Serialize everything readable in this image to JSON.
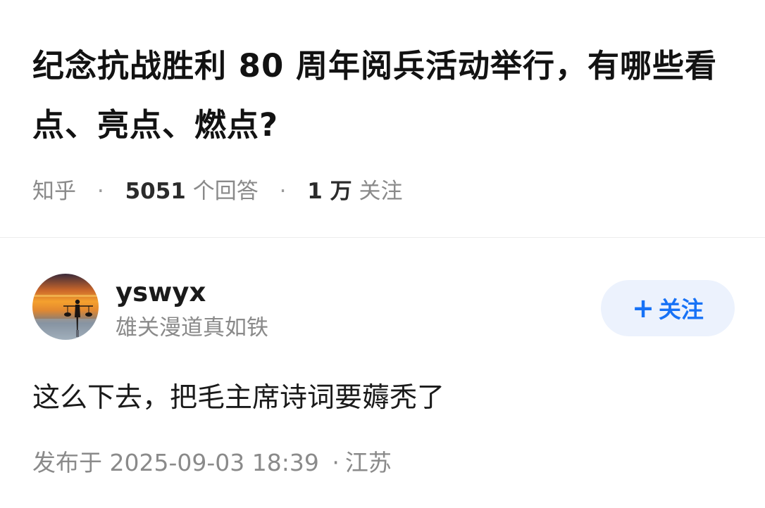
{
  "question": {
    "title": "纪念抗战胜利 80 周年阅兵活动举行，有哪些看点、亮点、燃点?",
    "source": "知乎",
    "answer_count": "5051",
    "answer_count_label": "个回答",
    "follower_count": "1 万",
    "follower_label": "关注",
    "separator": "·"
  },
  "answer": {
    "author": {
      "name": "yswyx",
      "bio": "雄关漫道真如铁",
      "avatar_icon": "sunset-fisherman-avatar"
    },
    "follow_button": {
      "plus": "+",
      "label": "关注"
    },
    "content": "这么下去，把毛主席诗词要薅秃了",
    "published_label": "发布于",
    "published_datetime": "2025-09-03  18:39",
    "separator": "·",
    "location": "江苏"
  },
  "colors": {
    "accent": "#1772f6",
    "follow_bg": "#ecf2fd",
    "meta_text": "#8a8a8a",
    "title_text": "#121212"
  }
}
